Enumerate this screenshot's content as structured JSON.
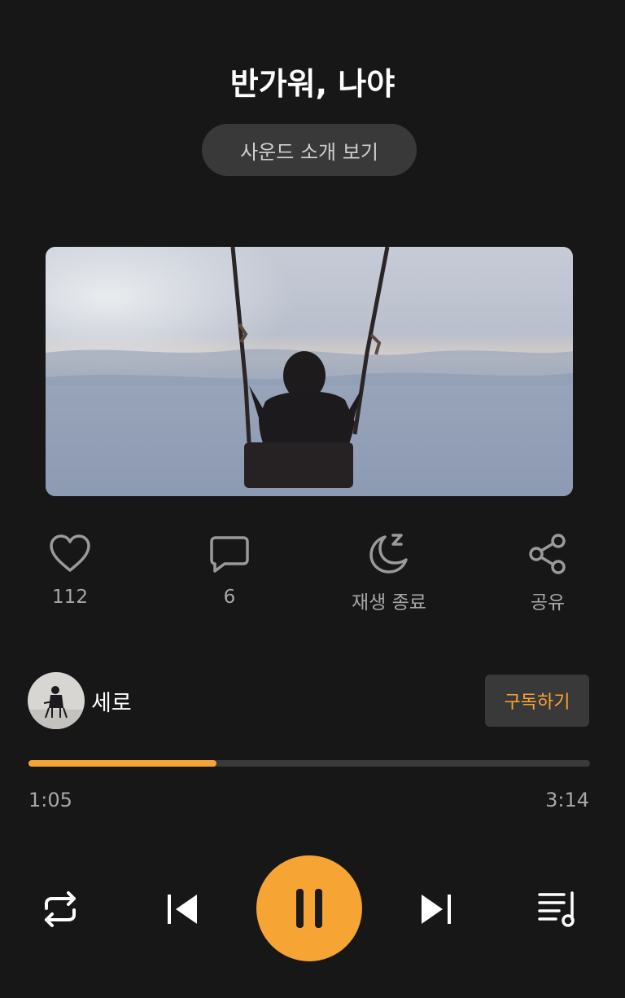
{
  "header": {
    "title": "반가워, 나야",
    "intro_button": "사운드 소개 보기"
  },
  "actions": [
    {
      "icon": "heart-icon",
      "label": "112"
    },
    {
      "icon": "comment-icon",
      "label": "6"
    },
    {
      "icon": "sleep-timer-moon-icon",
      "label": "재생 종료"
    },
    {
      "icon": "share-icon",
      "label": "공유"
    }
  ],
  "creator": {
    "name": "세로",
    "subscribe_label": "구독하기"
  },
  "player": {
    "current_time": "1:05",
    "total_time": "3:14",
    "progress": 0.335,
    "accent_color": "#f6a434",
    "controls": [
      "repeat-icon",
      "previous-icon",
      "pause-icon",
      "next-icon",
      "playlist-icon"
    ]
  }
}
